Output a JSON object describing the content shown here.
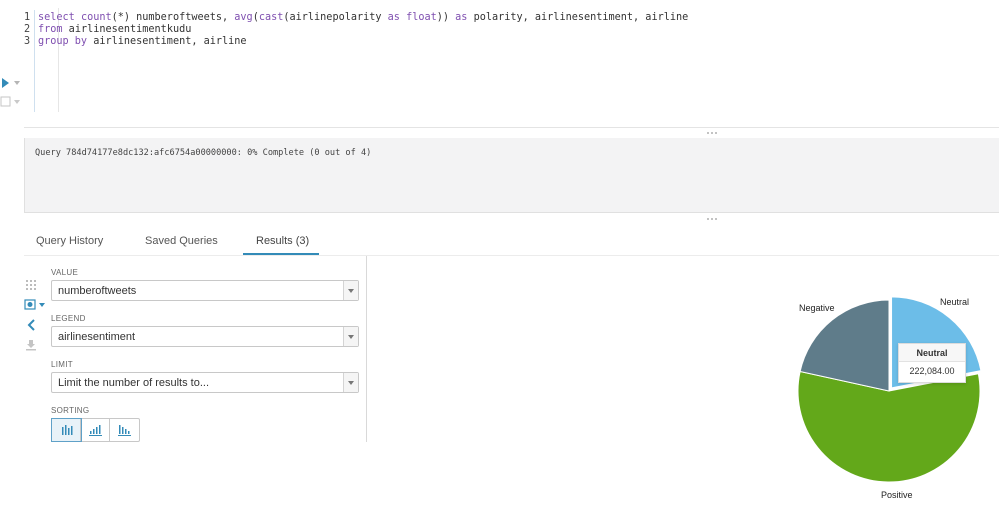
{
  "editor": {
    "lines": [
      {
        "num": "1",
        "tokens": [
          {
            "t": "select ",
            "c": "kw"
          },
          {
            "t": "count",
            "c": "fn"
          },
          {
            "t": "(*) numberoftweets, ",
            "c": "id"
          },
          {
            "t": "avg",
            "c": "fn"
          },
          {
            "t": "(",
            "c": "id"
          },
          {
            "t": "cast",
            "c": "fn"
          },
          {
            "t": "(airlinepolarity ",
            "c": "id"
          },
          {
            "t": "as",
            "c": "kw"
          },
          {
            "t": " ",
            "c": "id"
          },
          {
            "t": "float",
            "c": "kw"
          },
          {
            "t": ")) ",
            "c": "id"
          },
          {
            "t": "as",
            "c": "kw"
          },
          {
            "t": " polarity, airlinesentiment, airline",
            "c": "id"
          }
        ]
      },
      {
        "num": "2",
        "tokens": [
          {
            "t": "from",
            "c": "kw"
          },
          {
            "t": " airlinesentimentkudu",
            "c": "id"
          }
        ]
      },
      {
        "num": "3",
        "tokens": [
          {
            "t": "group by",
            "c": "kw"
          },
          {
            "t": " airlinesentiment, airline",
            "c": "id"
          }
        ]
      }
    ]
  },
  "query_status": "Query 784d74177e8dc132:afc6754a00000000: 0% Complete (0 out of 4)",
  "tabs": [
    {
      "label": "Query History"
    },
    {
      "label": "Saved Queries"
    },
    {
      "label": "Results (3)"
    }
  ],
  "settings": {
    "value_label": "VALUE",
    "value": "numberoftweets",
    "legend_label": "LEGEND",
    "legend": "airlinesentiment",
    "limit_label": "LIMIT",
    "limit": "Limit the number of results to...",
    "sorting_label": "SORTING"
  },
  "colors": {
    "accent": "#338bb8",
    "negative": "#5f7c8a",
    "neutral": "#6cbde8",
    "positive": "#63a81a"
  },
  "chart_data": {
    "type": "pie",
    "slices": [
      {
        "label": "Neutral",
        "value": 222084.0
      },
      {
        "label": "Positive",
        "value": 571000
      },
      {
        "label": "Negative",
        "value": 218000
      }
    ],
    "tooltip": {
      "title": "Neutral",
      "value": "222,084.00"
    }
  }
}
